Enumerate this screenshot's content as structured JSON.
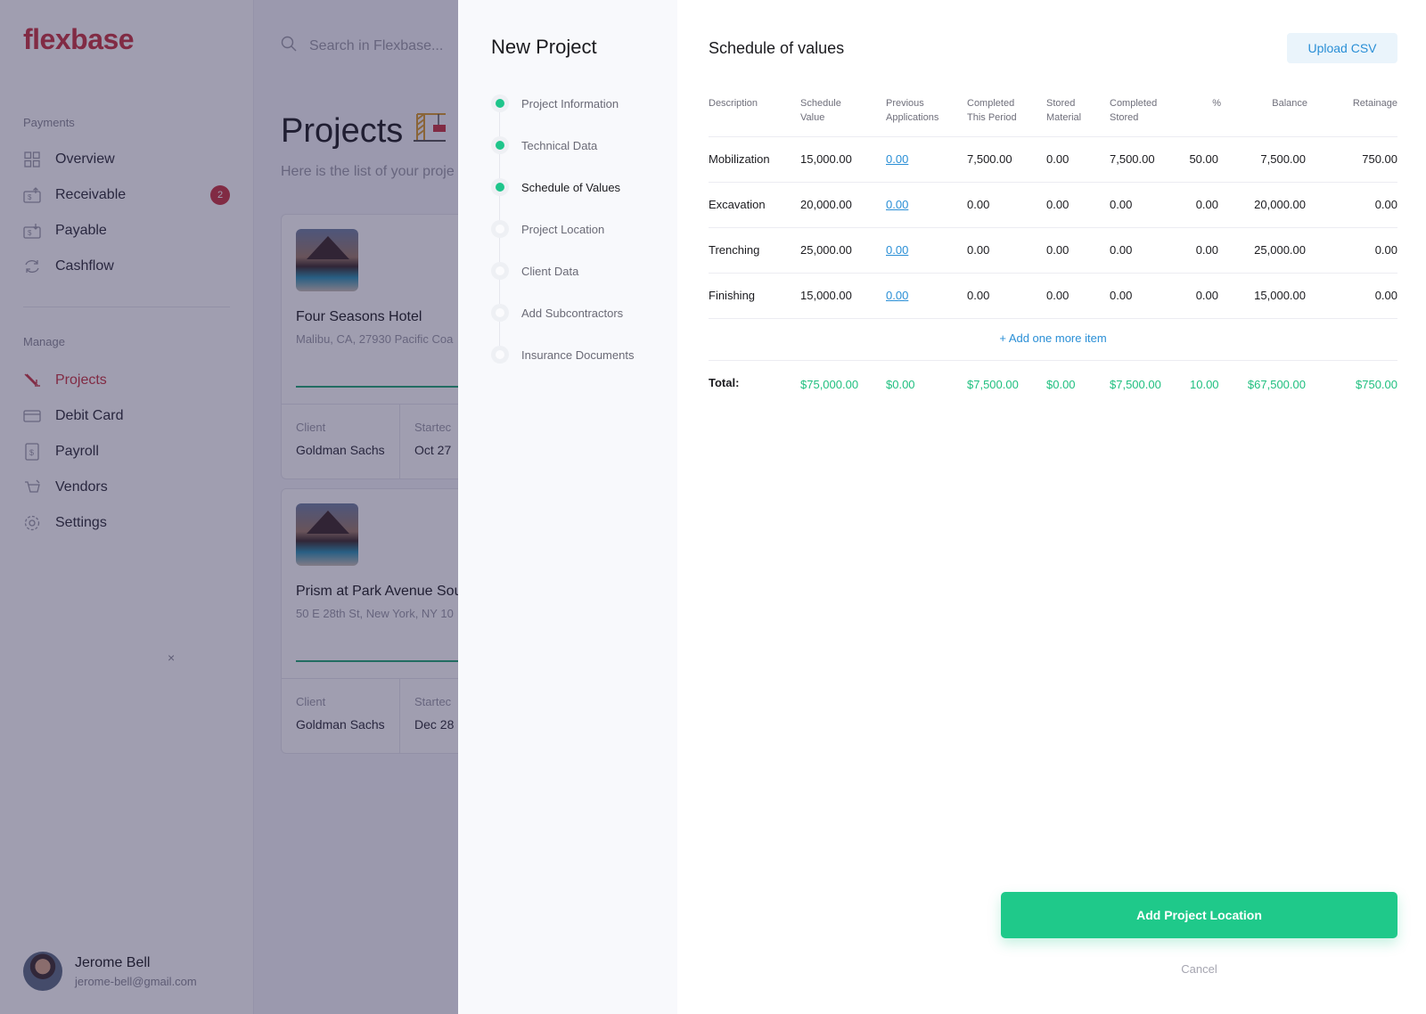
{
  "app": {
    "logo": "flexbase"
  },
  "sidebar": {
    "payments_title": "Payments",
    "payments_items": [
      {
        "label": "Overview",
        "icon": "grid-icon"
      },
      {
        "label": "Receivable",
        "icon": "receivable-icon",
        "badge": "2"
      },
      {
        "label": "Payable",
        "icon": "payable-icon"
      },
      {
        "label": "Cashflow",
        "icon": "cashflow-icon"
      }
    ],
    "manage_title": "Manage",
    "manage_items": [
      {
        "label": "Projects",
        "icon": "crane-icon",
        "active": true
      },
      {
        "label": "Debit Card",
        "icon": "card-icon"
      },
      {
        "label": "Payroll",
        "icon": "payroll-icon"
      },
      {
        "label": "Vendors",
        "icon": "vendors-icon"
      },
      {
        "label": "Settings",
        "icon": "gear-icon"
      }
    ],
    "collapse_label": "×",
    "user": {
      "name": "Jerome Bell",
      "email": "jerome-bell@gmail.com"
    }
  },
  "main": {
    "search_placeholder": "Search in Flexbase...",
    "page_title": "Projects",
    "page_emoji": "🏗",
    "page_subtitle": "Here is the list of your proje",
    "cards": [
      {
        "title": "Four Seasons Hotel",
        "address": "Malibu, CA, 27930 Pacific Coa",
        "progress": 0.55,
        "client_label": "Client",
        "client": "Goldman Sachs",
        "started_label": "Startec",
        "started": "Oct 27"
      },
      {
        "title": "Prism at Park Avenue Sou",
        "address": "50 E 28th St, New York, NY 10",
        "progress": 0.55,
        "client_label": "Client",
        "client": "Goldman Sachs",
        "started_label": "Startec",
        "started": "Dec 28"
      }
    ]
  },
  "drawer": {
    "title": "New Project",
    "steps": [
      {
        "label": "Project Information",
        "state": "done"
      },
      {
        "label": "Technical Data",
        "state": "done"
      },
      {
        "label": "Schedule of Values",
        "state": "current"
      },
      {
        "label": "Project Location",
        "state": "pending"
      },
      {
        "label": "Client Data",
        "state": "pending"
      },
      {
        "label": "Add Subcontractors",
        "state": "pending"
      },
      {
        "label": "Insurance Documents",
        "state": "pending"
      }
    ],
    "section_title": "Schedule of values",
    "upload_label": "Upload CSV",
    "table": {
      "headers": [
        "Description",
        "Schedule\nValue",
        "Previous\nApplications",
        "Completed\nThis Period",
        "Stored\nMaterial",
        "Completed\nStored",
        "%",
        "Balance",
        "Retainage"
      ],
      "rows": [
        [
          "Mobilization",
          "15,000.00",
          "0.00",
          "7,500.00",
          "0.00",
          "7,500.00",
          "50.00",
          "7,500.00",
          "750.00"
        ],
        [
          "Excavation",
          "20,000.00",
          "0.00",
          "0.00",
          "0.00",
          "0.00",
          "0.00",
          "20,000.00",
          "0.00"
        ],
        [
          "Trenching",
          "25,000.00",
          "0.00",
          "0.00",
          "0.00",
          "0.00",
          "0.00",
          "25,000.00",
          "0.00"
        ],
        [
          "Finishing",
          "15,000.00",
          "0.00",
          "0.00",
          "0.00",
          "0.00",
          "0.00",
          "15,000.00",
          "0.00"
        ]
      ],
      "add_item_label": "+ Add one more item",
      "totals": [
        "Total:",
        "$75,000.00",
        "$0.00",
        "$7,500.00",
        "$0.00",
        "$7,500.00",
        "10.00",
        "$67,500.00",
        "$750.00"
      ]
    },
    "primary_button": "Add Project Location",
    "cancel_label": "Cancel"
  },
  "colors": {
    "brand": "#c8323f",
    "accent_green": "#1fc98a",
    "link_blue": "#2a8fd6",
    "overlay": "#26224a"
  }
}
